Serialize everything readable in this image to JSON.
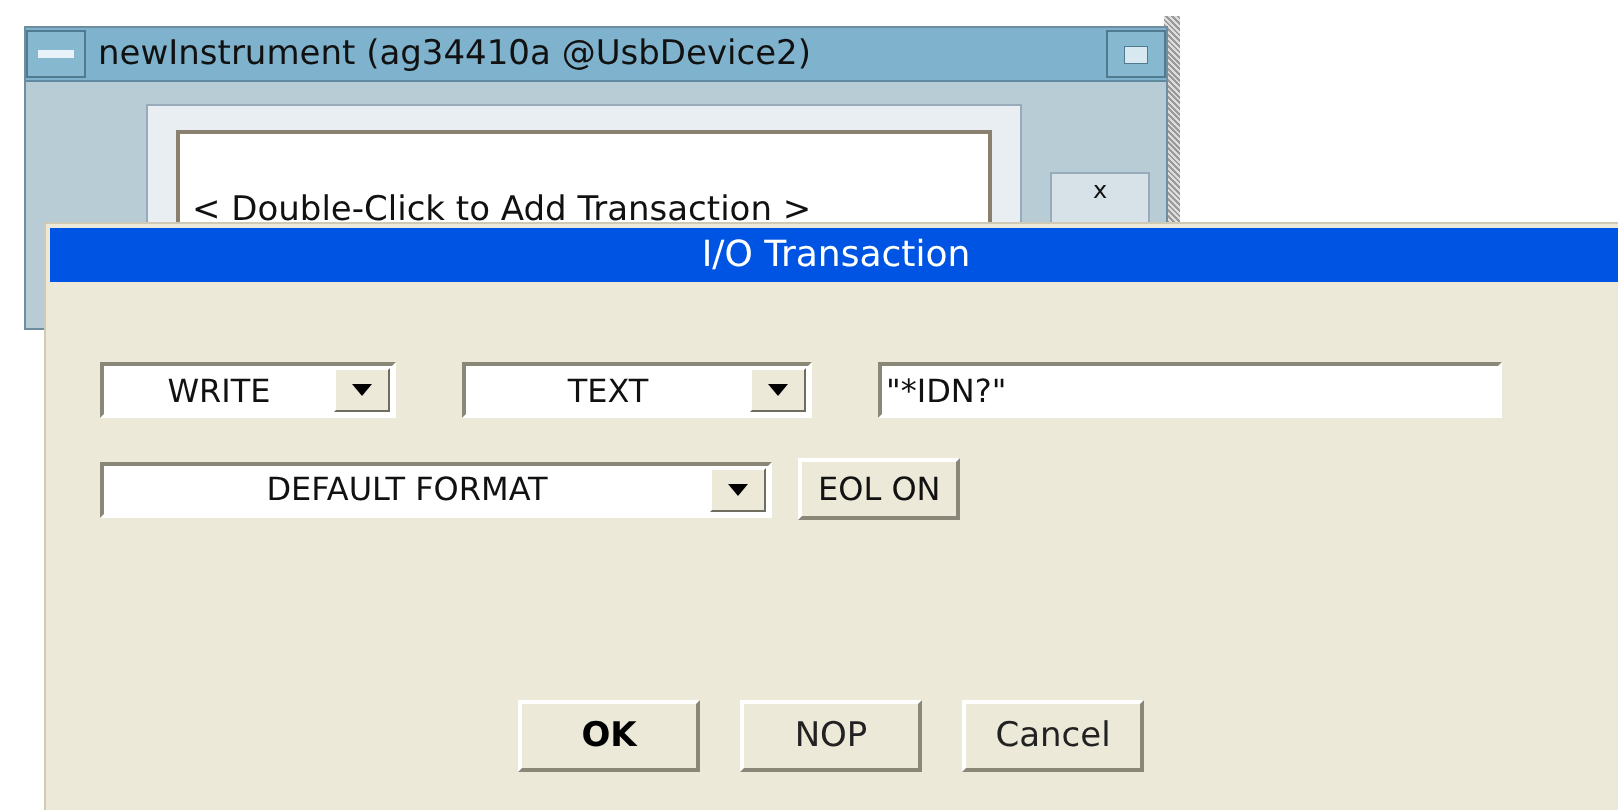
{
  "instrument_window": {
    "title": "newInstrument (ag34410a @UsbDevice2)",
    "placeholder_row": "< Double-Click to Add Transaction >",
    "side_button": "x"
  },
  "dialog": {
    "title": "I/O Transaction",
    "rows": [
      [
        {
          "kind": "dropdown",
          "value": "WRITE"
        },
        {
          "kind": "dropdown",
          "value": "TEXT"
        },
        {
          "kind": "field",
          "value": "\"*IDN?\""
        }
      ],
      [
        {
          "kind": "dropdown",
          "value": "DEFAULT FORMAT"
        },
        {
          "kind": "button",
          "value": "EOL ON"
        }
      ]
    ],
    "buttons": [
      {
        "label": "OK",
        "default": true
      },
      {
        "label": "NOP",
        "default": false
      },
      {
        "label": "Cancel",
        "default": false
      }
    ]
  }
}
